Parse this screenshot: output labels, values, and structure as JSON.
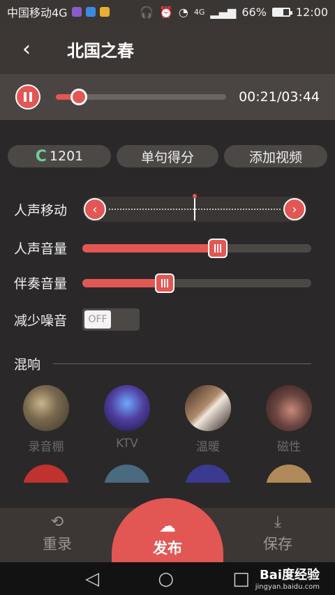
{
  "status_bar": {
    "carrier": "中国移动4G",
    "network_label": "4G",
    "battery_percent": "66%",
    "battery_level": 0.66,
    "time": "12:00",
    "icons": [
      "headphones-icon",
      "alarm-icon",
      "wifi-icon",
      "signal-icon",
      "battery-icon"
    ]
  },
  "header": {
    "back_icon": "‹",
    "title": "北国之春"
  },
  "player": {
    "time_display": "00:21/03:44",
    "progress_fraction": 0.094
  },
  "chips": {
    "score": "1201",
    "score_icon": "C",
    "sentence_score": "单句得分",
    "add_video": "添加视频"
  },
  "controls": {
    "vocal_shift_label": "人声移动",
    "vocal_volume_label": "人声音量",
    "vocal_volume_level": 0.59,
    "accompaniment_volume_label": "伴奏音量",
    "accompaniment_volume_level": 0.36,
    "noise_reduction_label": "减少噪音",
    "noise_reduction_state": "OFF"
  },
  "reverb": {
    "label": "混响",
    "presets": [
      {
        "label": "录音棚",
        "icon": "studio-mic-image"
      },
      {
        "label": "KTV",
        "icon": "ktv-room-image"
      },
      {
        "label": "温暖",
        "icon": "piano-keys-image"
      },
      {
        "label": "磁性",
        "icon": "magnetic-image"
      }
    ]
  },
  "actions": {
    "redo": "重录",
    "publish": "发布",
    "save": "保存"
  },
  "watermark": {
    "top": "Bai度经验",
    "bottom": "jingyan.baidu.com"
  },
  "colors": {
    "accent": "#e25754",
    "background": "#2a2828"
  }
}
